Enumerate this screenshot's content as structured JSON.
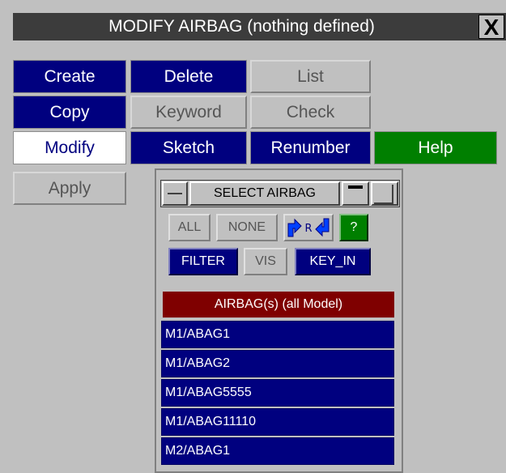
{
  "window": {
    "title": "MODIFY AIRBAG (nothing defined)",
    "close_label": "X"
  },
  "menu": {
    "create": "Create",
    "delete": "Delete",
    "list": "List",
    "copy": "Copy",
    "keyword": "Keyword",
    "check": "Check",
    "modify": "Modify",
    "sketch": "Sketch",
    "renumber": "Renumber",
    "help": "Help",
    "apply": "Apply"
  },
  "select_panel": {
    "title": "SELECT AIRBAG",
    "all": "ALL",
    "none": "NONE",
    "reverse_icon_text": "R",
    "question": "?",
    "filter": "FILTER",
    "vis": "VIS",
    "key_in": "KEY_IN",
    "list_header": "AIRBAG(s) (all Model)",
    "items": [
      "M1/ABAG1",
      "M1/ABAG2",
      "M1/ABAG5555",
      "M1/ABAG11110",
      "M2/ABAG1"
    ]
  },
  "colors": {
    "navy": "#00007f",
    "green": "#007f00",
    "maroon": "#7f0000",
    "grey": "#c0c0c0"
  }
}
